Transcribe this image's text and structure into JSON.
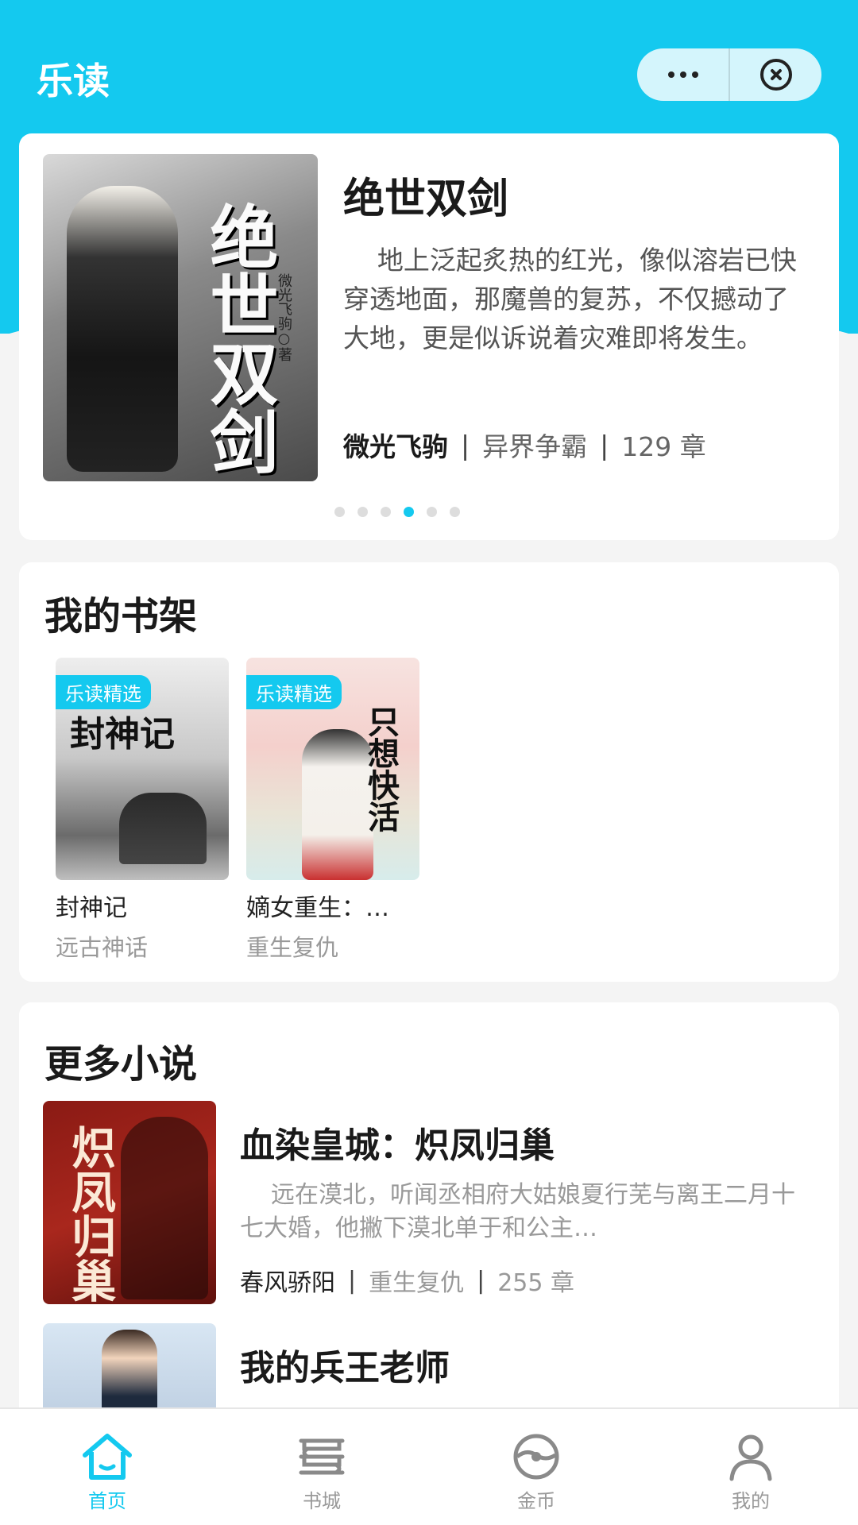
{
  "header": {
    "title": "乐读",
    "more_icon": "more-dots-icon",
    "close_icon": "close-circle-icon"
  },
  "banner": {
    "cover_title": "绝世双剑",
    "cover_author": "微光飞驹○著",
    "title": "绝世双剑",
    "description": "地上泛起炙热的红光，像似溶岩已快穿透地面，那魔兽的复苏，不仅撼动了大地，更是似诉说着灾难即将发生。",
    "author": "微光飞驹",
    "genre": "异界争霸",
    "chapters": "129 章",
    "page_count": 6,
    "active_page": 4
  },
  "shelf": {
    "title": "我的书架",
    "items": [
      {
        "tag": "乐读精选",
        "cover_text": "封神记",
        "name": "封神记",
        "genre": "远古神话"
      },
      {
        "tag": "乐读精选",
        "cover_text": "只想快活",
        "name": "嫡女重生：…",
        "genre": "重生复仇"
      }
    ]
  },
  "more": {
    "title": "更多小说",
    "items": [
      {
        "cover_text": "炽凤归巢",
        "title": "血染皇城：炽凤归巢",
        "description": "远在漠北，听闻丞相府大姑娘夏行芜与离王二月十七大婚，他撇下漠北单于和公主…",
        "author": "春风骄阳",
        "genre": "重生复仇",
        "chapters": "255 章"
      },
      {
        "title": "我的兵王老师"
      }
    ]
  },
  "tabbar": {
    "items": [
      {
        "label": "首页",
        "icon": "home-icon",
        "active": true
      },
      {
        "label": "书城",
        "icon": "bookstore-icon",
        "active": false
      },
      {
        "label": "金币",
        "icon": "coin-icon",
        "active": false
      },
      {
        "label": "我的",
        "icon": "profile-icon",
        "active": false
      }
    ]
  },
  "colors": {
    "accent": "#14c9ef",
    "background": "#f4f4f4",
    "inactive_tab": "#999999"
  }
}
